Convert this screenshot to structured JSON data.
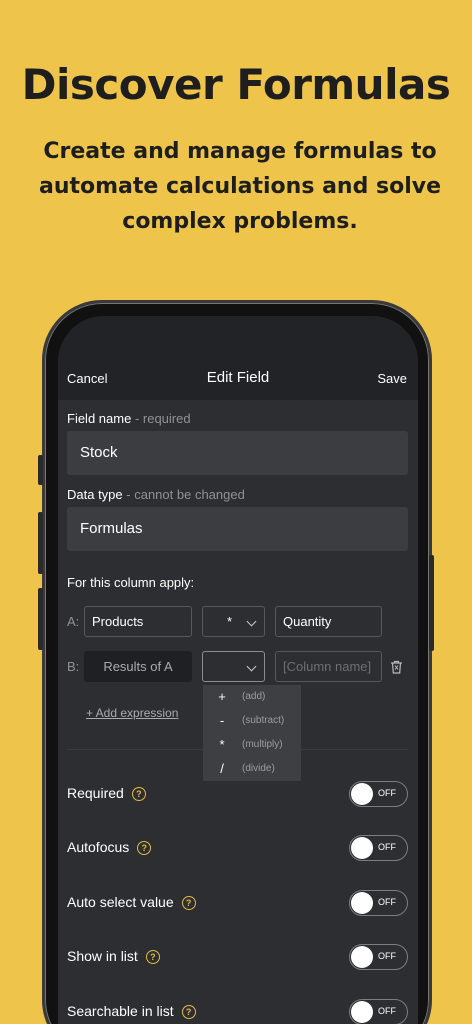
{
  "hero": {
    "title": "Discover Formulas",
    "subtitle": "Create and manage formulas to automate calculations and solve complex problems."
  },
  "nav": {
    "cancel": "Cancel",
    "title": "Edit Field",
    "save": "Save"
  },
  "field_name": {
    "label": "Field name",
    "hint": "- required",
    "value": "Stock"
  },
  "data_type": {
    "label": "Data type",
    "hint": "- cannot be changed",
    "value": "Formulas"
  },
  "apply": {
    "label": "For this column apply:",
    "row_a": {
      "letter": "A:",
      "left": "Products",
      "operator": "*",
      "right": "Quantity"
    },
    "row_b": {
      "letter": "B:",
      "left": "Results of A",
      "operator": "",
      "right_placeholder": "[Column name]"
    },
    "add_expression": "+ Add expression"
  },
  "operators": [
    {
      "symbol": "+",
      "name": "(add)"
    },
    {
      "symbol": "-",
      "name": "(subtract)"
    },
    {
      "symbol": "*",
      "name": "(multiply)"
    },
    {
      "symbol": "/",
      "name": "(divide)"
    }
  ],
  "options": [
    {
      "label": "Required",
      "state": "OFF"
    },
    {
      "label": "Autofocus",
      "state": "OFF"
    },
    {
      "label": "Auto select value",
      "state": "OFF"
    },
    {
      "label": "Show in list",
      "state": "OFF"
    },
    {
      "label": "Searchable in list",
      "state": "OFF"
    }
  ],
  "colors": {
    "background": "#EEC44B",
    "screen": "#2C2E31",
    "accent": "#E6BA45"
  },
  "icons": {
    "help": "help-circle-icon",
    "trash": "trash-icon",
    "chevron": "chevron-down-icon"
  }
}
